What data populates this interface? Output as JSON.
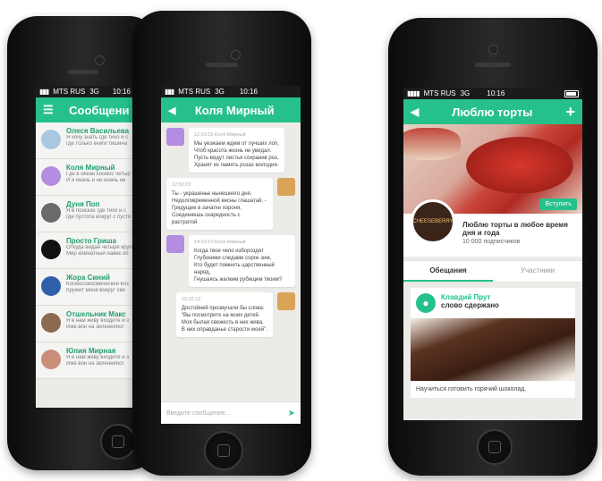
{
  "colors": {
    "accent": "#26c18a",
    "name_green": "#1f9f70"
  },
  "status": {
    "carrier": "MTS RUS",
    "network": "3G",
    "time": "10:16"
  },
  "phone1": {
    "title": "Сообщени",
    "contacts": [
      {
        "name": "Олеся Васильева",
        "preview": [
          "Я хочу знать где тихо и с",
          "где только книги тишина"
        ],
        "avatar_color": "#a9c7e0"
      },
      {
        "name": "Коля Мирный",
        "preview": [
          "Где в океан космос четыр",
          "И я иначь и не иначь не"
        ],
        "avatar_color": "#b48ce0"
      },
      {
        "name": "Дуня Поп",
        "preview": [
          "Я в поисках где тихо и с",
          "где пустота вокруг с пусто"
        ],
        "avatar_color": "#6a6a6a"
      },
      {
        "name": "Просто Гриша",
        "preview": [
          "Откуда видан четыре кругом",
          "Мир комнатный навек об"
        ],
        "avatar_color": "#111111"
      },
      {
        "name": "Жора Синий",
        "preview": [
          "Космосокосмический Кос",
          "Кружит меня вокруг све"
        ],
        "avatar_color": "#2f5fa8"
      },
      {
        "name": "Отшельник Макс",
        "preview": [
          "Я в нам живу входите и з",
          "Иже вон на зеленейбог"
        ],
        "avatar_color": "#8a6a50"
      },
      {
        "name": "Юлия Мирная",
        "preview": [
          "Я в нам живу входите и з",
          "Иже вон на зеленейбог"
        ],
        "avatar_color": "#c98d7a"
      }
    ]
  },
  "phone2": {
    "title": "Коля Мирный",
    "messages": [
      {
        "side": "left",
        "meta": "12:03:15  Коля Мирный",
        "lines": [
          "Мы уезжаем ждем от лучших лоп,",
          "Чтоб красота жизнь не увидал.",
          "Пусть видут листья сохранив роз,",
          "Хранят их память розах молодия."
        ]
      },
      {
        "side": "right",
        "meta": "12:03:15",
        "lines": [
          "Ты - украшенье нынешнего дня,",
          "Недолговременной весны глашатай, -",
          "Грядущее в зачатке хороня,",
          "Соединяешь скаредность с растратой."
        ]
      },
      {
        "side": "left",
        "meta": "14:02:13  Коля Мирный",
        "lines": [
          "Когда твое чело избороздят",
          "Глубокими следами сорок зим,",
          "Кто будет помнить царственный наряд,",
          "Гнушаясь жалким рубищем твоим?"
        ]
      },
      {
        "side": "right",
        "meta": "15:02:13",
        "lines": [
          "Достойней прозвучали бы слова:",
          "\"Вы посмотрите на моих детей.",
          "Моя былая свежесть в них жива,",
          "В них оправданье старости моей\"."
        ]
      }
    ],
    "input_placeholder": "Введите сообщение..."
  },
  "phone3": {
    "title": "Люблю торты",
    "logo_text": "CHEESEBERRY",
    "join_label": "Вступить",
    "group_name_line1": "Люблю торты в любое время",
    "group_name_line2": "дня и года",
    "subscribers": "10 000 подписчиков",
    "tabs": [
      "Обещания",
      "Участники"
    ],
    "post": {
      "author": "Клавдий Прут",
      "subtitle": "слово сдержано",
      "caption": "Научиться готовить горячий шоколад."
    }
  }
}
